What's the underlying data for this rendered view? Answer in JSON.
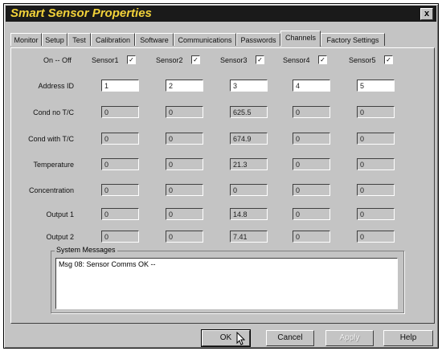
{
  "window": {
    "title": "Smart Sensor Properties",
    "close_label": "x"
  },
  "tabs": [
    "Monitor",
    "Setup",
    "Test",
    "Calibration",
    "Software",
    "Communications",
    "Passwords",
    "Channels",
    "Factory Settings"
  ],
  "active_tab": "Channels",
  "channels": {
    "on_off_label": "On -- Off",
    "sensors": [
      {
        "label": "Sensor1",
        "checked": true,
        "address": "1",
        "cond_no_tc": "0",
        "cond_with_tc": "0",
        "temperature": "0",
        "concentration": "0",
        "output1": "0",
        "output2": "0"
      },
      {
        "label": "Sensor2",
        "checked": true,
        "address": "2",
        "cond_no_tc": "0",
        "cond_with_tc": "0",
        "temperature": "0",
        "concentration": "0",
        "output1": "0",
        "output2": "0"
      },
      {
        "label": "Sensor3",
        "checked": true,
        "address": "3",
        "cond_no_tc": "625.5",
        "cond_with_tc": "674.9",
        "temperature": "21.3",
        "concentration": "0",
        "output1": "14.8",
        "output2": "7.41"
      },
      {
        "label": "Sensor4",
        "checked": true,
        "address": "4",
        "cond_no_tc": "0",
        "cond_with_tc": "0",
        "temperature": "0",
        "concentration": "0",
        "output1": "0",
        "output2": "0"
      },
      {
        "label": "Sensor5",
        "checked": true,
        "address": "5",
        "cond_no_tc": "0",
        "cond_with_tc": "0",
        "temperature": "0",
        "concentration": "0",
        "output1": "0",
        "output2": "0"
      }
    ],
    "rows": {
      "address": "Address ID",
      "cond_no_tc": "Cond no T/C",
      "cond_with_tc": "Cond with T/C",
      "temperature": "Temperature",
      "concentration": "Concentration",
      "output1": "Output 1",
      "output2": "Output 2"
    }
  },
  "system_messages": {
    "title": "System Messages",
    "text": "Msg 08: Sensor Comms OK  --"
  },
  "buttons": {
    "ok": "OK",
    "cancel": "Cancel",
    "apply": "Apply",
    "help": "Help"
  },
  "colors": {
    "title_bg": "#1a1a1a",
    "title_text": "#f2d23a",
    "face": "#c4c4c4"
  }
}
